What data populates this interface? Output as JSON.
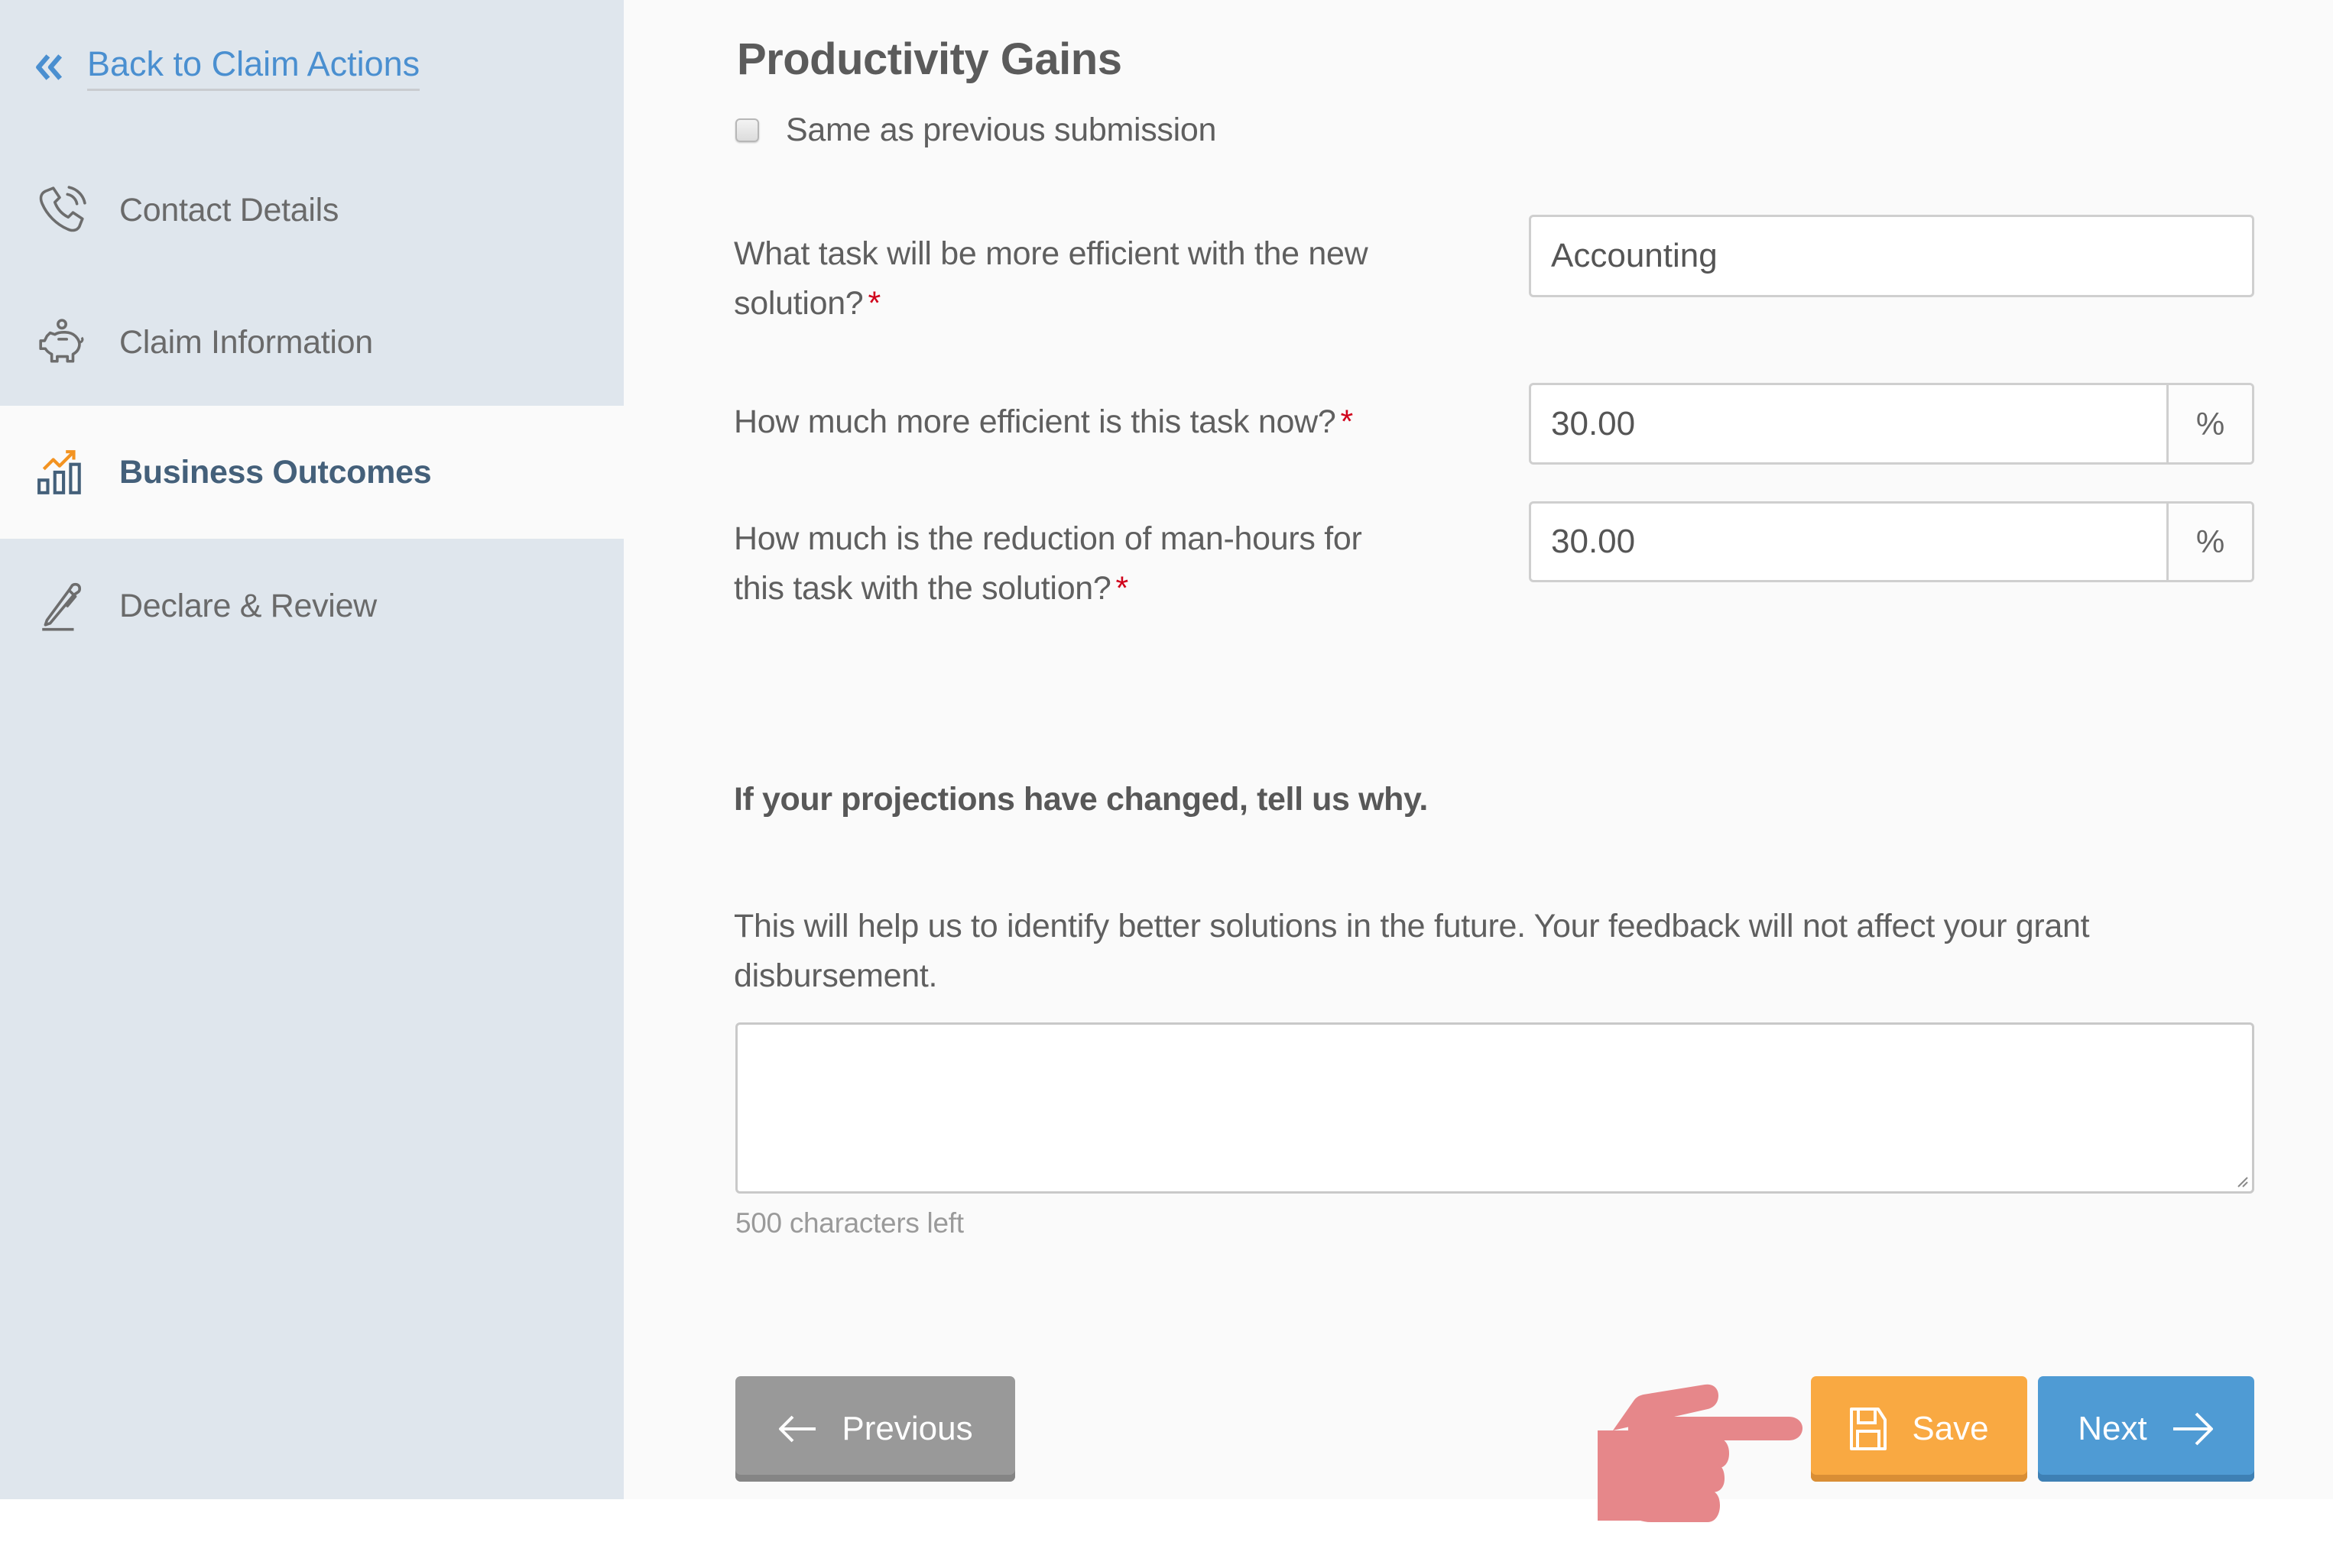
{
  "sidebar": {
    "back_link": {
      "label": "Back to Claim Actions",
      "icon": "double-chevron-left-icon"
    },
    "items": [
      {
        "label": "Contact Details",
        "icon": "phone-icon",
        "active": false
      },
      {
        "label": "Claim Information",
        "icon": "piggy-bank-icon",
        "active": false
      },
      {
        "label": "Business Outcomes",
        "icon": "bar-chart-trend-icon",
        "active": true
      },
      {
        "label": "Declare & Review",
        "icon": "pen-signature-icon",
        "active": false
      }
    ]
  },
  "main": {
    "title": "Productivity Gains",
    "same_as_previous": {
      "label": "Same as previous submission",
      "checked": false
    },
    "questions": [
      {
        "label": "What task will be more efficient with the new solution?",
        "required_mark": "*",
        "value": "Accounting",
        "suffix": null
      },
      {
        "label": "How much more efficient is this task now?",
        "required_mark": "*",
        "value": "30.00",
        "suffix": "%"
      },
      {
        "label": "How much is the reduction of man-hours for this task with the solution?",
        "required_mark": "*",
        "value": "30.00",
        "suffix": "%"
      }
    ],
    "feedback": {
      "heading": "If your projections have changed, tell us why.",
      "help_text": "This will help us to identify better solutions in the future. Your feedback will not affect your grant disbursement.",
      "value": "",
      "char_count": "500 characters left"
    },
    "buttons": {
      "previous": "Previous",
      "save": "Save",
      "next": "Next"
    }
  },
  "colors": {
    "sidebar_bg": "#dfe6ed",
    "link": "#4a8fd0",
    "active_nav": "#44607a",
    "save": "#f9a942",
    "next": "#4f9bd4",
    "previous": "#999999",
    "required": "#d0021b",
    "pointer_hand": "#e6878a"
  },
  "annotation": {
    "pointer": "hand-pointing-at-save"
  }
}
